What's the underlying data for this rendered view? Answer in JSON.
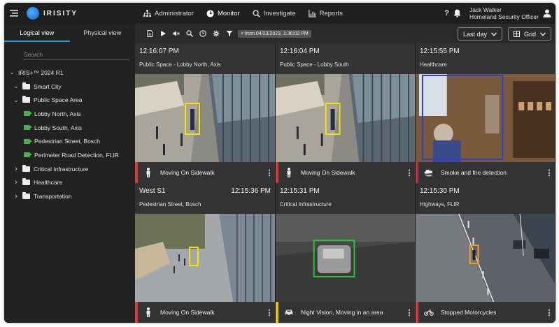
{
  "app": {
    "logo_text": "IRISITY"
  },
  "nav": [
    {
      "label": "Administrator",
      "icon": "sitemap-icon",
      "active": false
    },
    {
      "label": "Monitor",
      "icon": "clock-icon",
      "active": true
    },
    {
      "label": "Investigate",
      "icon": "search-icon",
      "active": false
    },
    {
      "label": "Reports",
      "icon": "chart-icon",
      "active": false
    }
  ],
  "user": {
    "name": "Jack Walker",
    "role": "Homeland Security Officer"
  },
  "sidebar": {
    "tabs": [
      "Logical view",
      "Physical view"
    ],
    "search_placeholder": "Search",
    "tree": [
      {
        "label": "IRIS+™ 2024 R1",
        "level": 0,
        "type": "root",
        "expanded": true
      },
      {
        "label": "Smart City",
        "level": 1,
        "type": "folder-open",
        "expanded": true
      },
      {
        "label": "Public Space Area",
        "level": 1,
        "type": "folder-open",
        "expanded": true
      },
      {
        "label": "Lobby North, Axis",
        "level": 2,
        "type": "camera"
      },
      {
        "label": "Lobby South, Axis",
        "level": 2,
        "type": "camera"
      },
      {
        "label": "Pedestrian Street, Bosch",
        "level": 2,
        "type": "camera"
      },
      {
        "label": "Perimeter Road Detection, FLIR",
        "level": 2,
        "type": "camera"
      },
      {
        "label": "Critical Infrastructure",
        "level": 1,
        "type": "folder",
        "expanded": false
      },
      {
        "label": "Healthcare",
        "level": 1,
        "type": "folder",
        "expanded": false
      },
      {
        "label": "Transportation",
        "level": 1,
        "type": "folder",
        "expanded": false
      }
    ]
  },
  "toolbar": {
    "filter_chip": "× from 04/23/2023, 1:36:02 PM",
    "range_label": "Last day",
    "view_label": "Grid"
  },
  "tiles": [
    {
      "prefix": "",
      "time": "12:16:07 PM",
      "location": "Public Space - Lobby North, Axis",
      "event": "Moving On Sidewalk",
      "severity_color": "#d63a3a",
      "event_icon": "person-icon",
      "scene": "plaza"
    },
    {
      "prefix": "",
      "time": "12:16:04 PM",
      "location": "Public Space - Lobby South",
      "event": "Moving On Sidewalk",
      "severity_color": "#d63a3a",
      "event_icon": "person-icon",
      "scene": "plaza"
    },
    {
      "prefix": "",
      "time": "12:15:55 PM",
      "location": "Healthcare",
      "event": "Smoke and fire detection",
      "severity_color": "#b5313d",
      "event_icon": "smoke-icon",
      "scene": "room"
    },
    {
      "prefix": "West S1",
      "time": "12:15:36 PM",
      "location": "Pedestrian Street, Bosch",
      "event": "Moving On Sidewalk",
      "severity_color": "#d63a3a",
      "event_icon": "person-icon",
      "scene": "street"
    },
    {
      "prefix": "",
      "time": "12:15:31 PM",
      "location": "Critical Infrastructure",
      "event": "Night Vision, Moving in an area",
      "severity_color": "#e8c21c",
      "event_icon": "car-icon",
      "scene": "thermal"
    },
    {
      "prefix": "",
      "time": "12:15:30 PM",
      "location": "Highways, FLIR",
      "event": "Stopped Motorcycles",
      "severity_color": "#d63a3a",
      "event_icon": "motorcycle-icon",
      "scene": "highway"
    }
  ]
}
